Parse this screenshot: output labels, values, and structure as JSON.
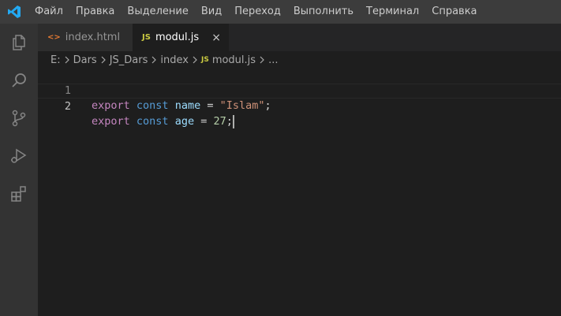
{
  "menu": {
    "items": [
      "Файл",
      "Правка",
      "Выделение",
      "Вид",
      "Переход",
      "Выполнить",
      "Терминал",
      "Справка"
    ]
  },
  "colors": {
    "accent": "#23a9f2",
    "js_badge": "#cbcb41",
    "html_icon": "#e37933"
  },
  "activity_bar": {
    "icons": [
      "explorer-icon",
      "search-icon",
      "source-control-icon",
      "run-debug-icon",
      "extensions-icon"
    ]
  },
  "tabs": [
    {
      "icon": "<>",
      "label": "index.html",
      "active": false
    },
    {
      "icon": "JS",
      "label": "modul.js",
      "active": true,
      "close": "×"
    }
  ],
  "breadcrumb": {
    "items": [
      "E:",
      "Dars",
      "JS_Dars",
      "index",
      "modul.js",
      "..."
    ],
    "file_icon": "JS"
  },
  "editor": {
    "lines": [
      {
        "number": "1",
        "tokens": [
          "export",
          "const",
          "name",
          "=",
          "\"Islam\"",
          ";"
        ]
      },
      {
        "number": "2",
        "tokens": [
          "export",
          "const",
          "age",
          "=",
          "27",
          ";"
        ]
      }
    ]
  }
}
